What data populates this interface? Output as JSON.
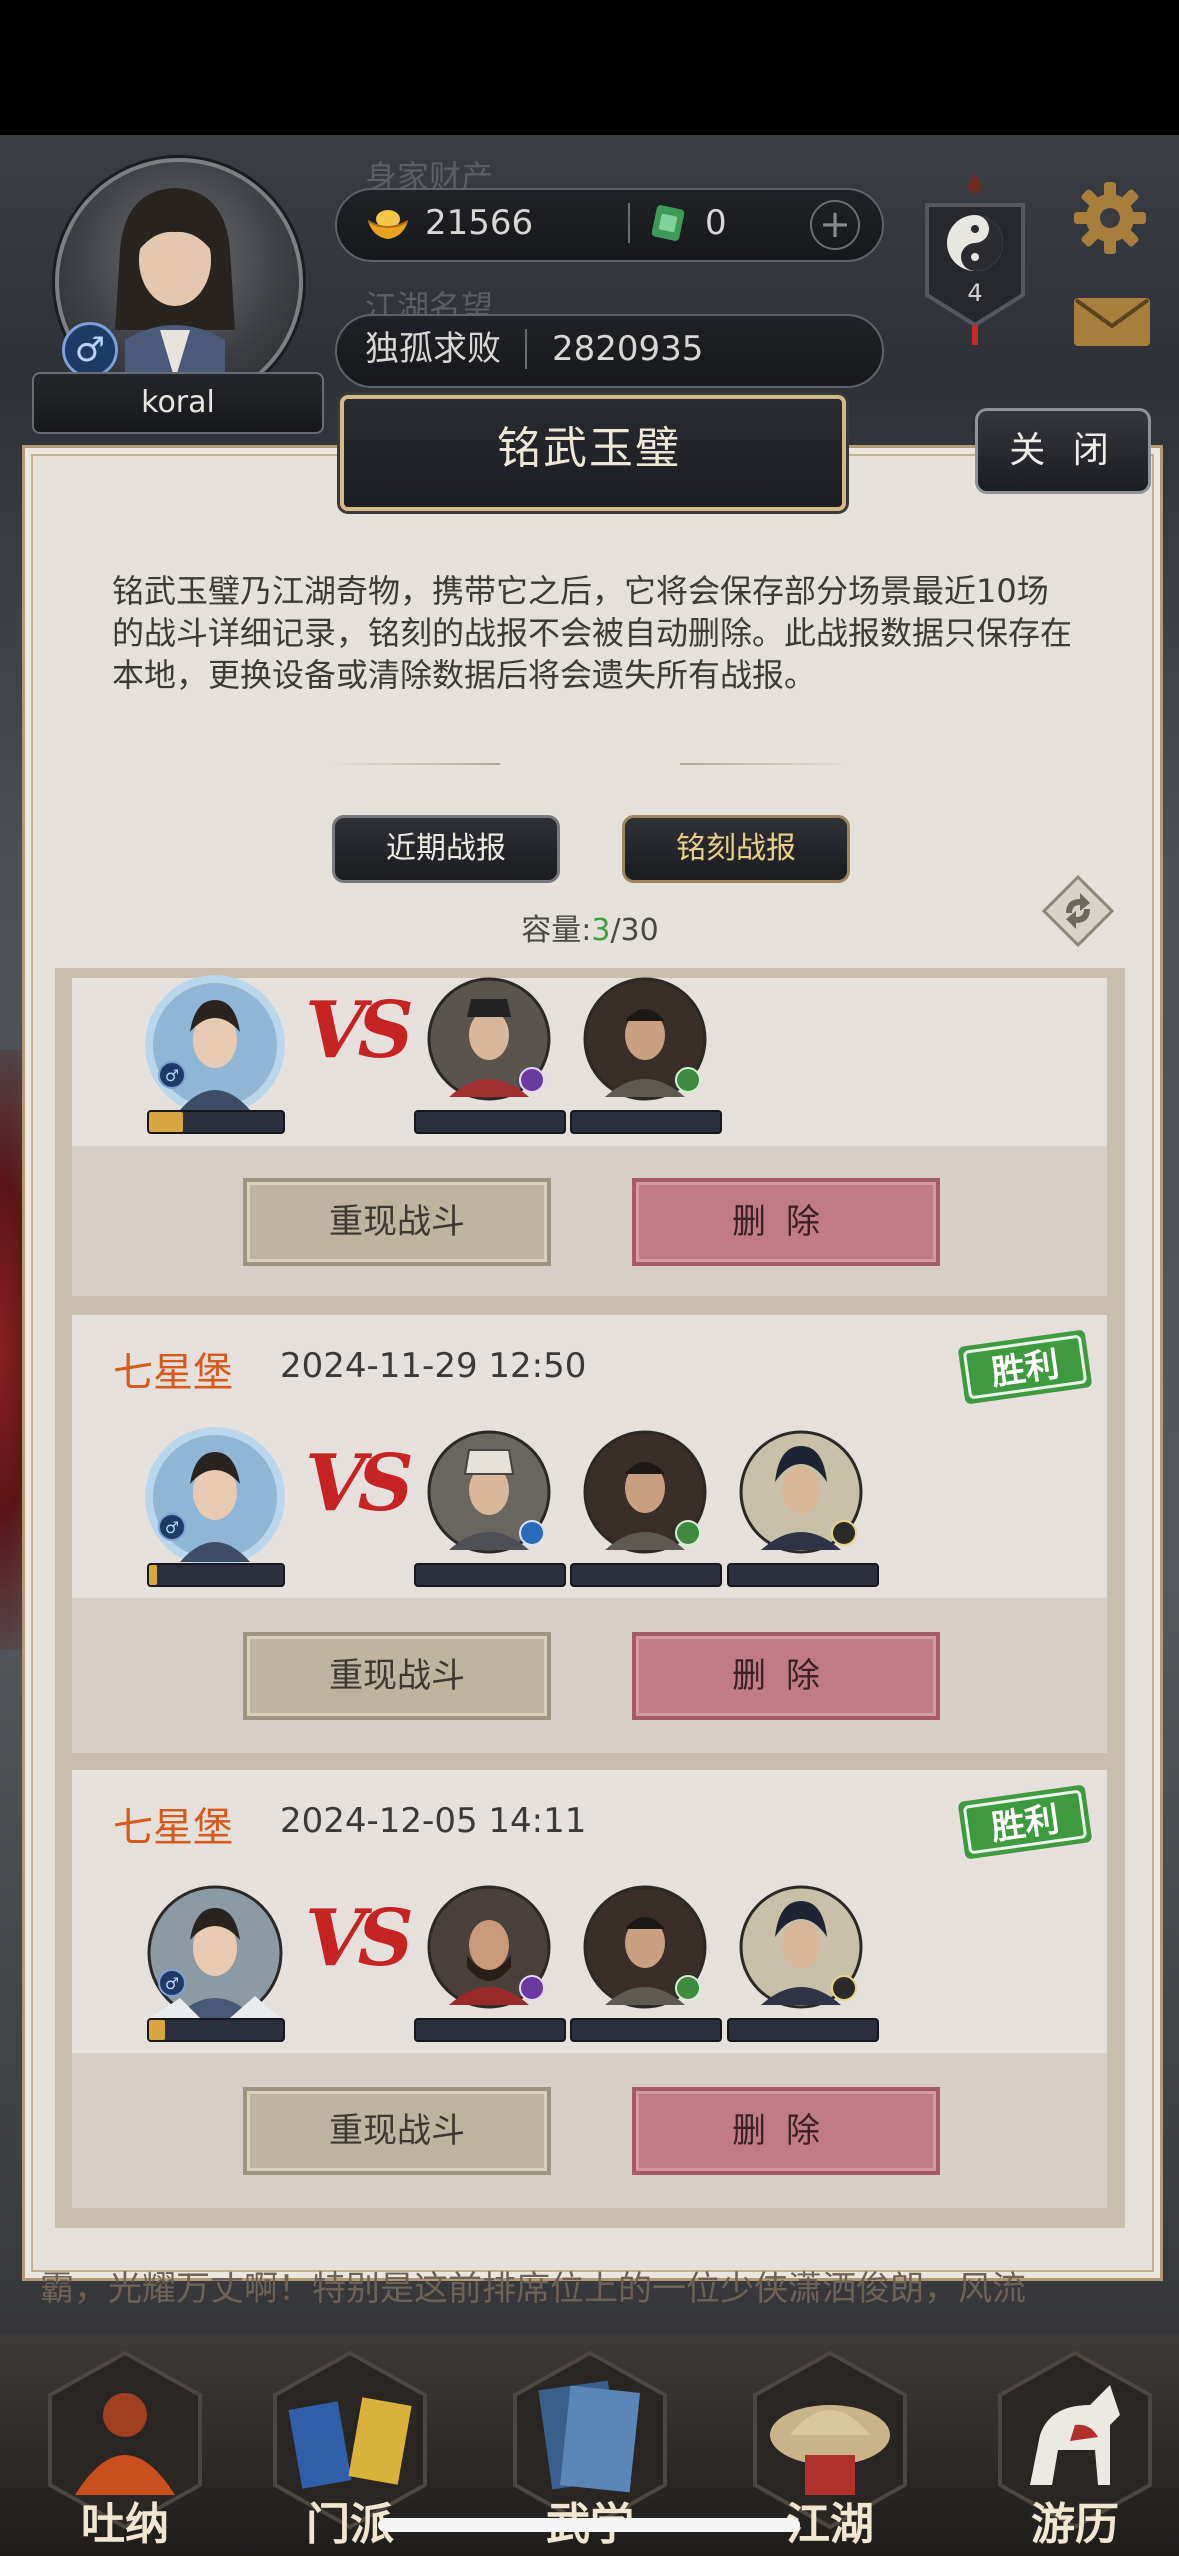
{
  "hud": {
    "player_name": "koral",
    "gender_symbol": "♂",
    "wealth_label": "身家财产",
    "gold_amount": "21566",
    "jade_amount": "0",
    "plus_symbol": "+",
    "reputation_label": "江湖名望",
    "reputation_title": "独孤求败",
    "reputation_value": "2820935",
    "emblem_level": "4"
  },
  "dialog": {
    "title": "铭武玉璧",
    "close_label": "关 闭",
    "description": "铭武玉璧乃江湖奇物，携带它之后，它将会保存部分场景最近10场的战斗详细记录，铭刻的战报不会被自动删除。此战报数据只保存在本地，更换设备或清除数据后将会遗失所有战报。",
    "tabs": [
      {
        "label": "近期战报"
      },
      {
        "label": "铭刻战报"
      }
    ],
    "capacity_label": "容量:",
    "capacity_used": "3",
    "capacity_total": "/30"
  },
  "records": [
    {
      "location": "",
      "date": "",
      "result": "",
      "hero_hp": 0.25,
      "enemy_count": 2,
      "replay_label": "重现战斗",
      "delete_label": "删除"
    },
    {
      "location": "七星堡",
      "date": "2024-11-29 12:50",
      "result": "胜利",
      "hero_hp": 0.06,
      "enemy_count": 3,
      "replay_label": "重现战斗",
      "delete_label": "删除"
    },
    {
      "location": "七星堡",
      "date": "2024-12-05 14:11",
      "result": "胜利",
      "hero_hp": 0.12,
      "enemy_count": 3,
      "replay_label": "重现战斗",
      "delete_label": "删除"
    }
  ],
  "vs_text": "VS",
  "story_text": "霸，光耀万丈啊！特别是这前排席位上的一位少侠潇洒俊朗，风流",
  "nav": [
    {
      "label": "吐纳",
      "icon": "meditation-icon"
    },
    {
      "label": "门派",
      "icon": "sect-icon"
    },
    {
      "label": "武学",
      "icon": "martial-book-icon"
    },
    {
      "label": "江湖",
      "icon": "jianghu-icon"
    },
    {
      "label": "游历",
      "icon": "horse-icon"
    }
  ],
  "colors": {
    "accent_orange": "#d55a1e",
    "win_green": "#3f9a3f",
    "delete_red": "#c07b86",
    "capacity_green": "#3ea03e"
  }
}
